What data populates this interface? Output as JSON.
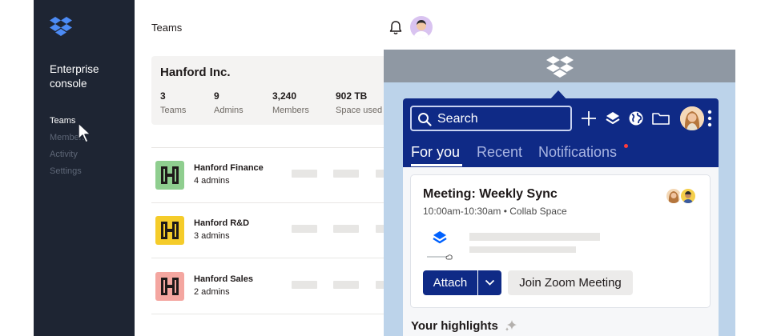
{
  "sidebar": {
    "console_title": "Enterprise console",
    "nav": [
      {
        "label": "Teams",
        "active": true
      },
      {
        "label": "Members",
        "active": false
      },
      {
        "label": "Activity",
        "active": false
      },
      {
        "label": "Settings",
        "active": false
      }
    ],
    "background": "#1e2533",
    "logo_icon": "dropbox-logo-icon"
  },
  "header": {
    "title": "Teams",
    "bell_icon": "bell-icon",
    "avatar": "user-avatar"
  },
  "org": {
    "name": "Hanford Inc.",
    "stats": [
      {
        "value": "3",
        "label": "Teams"
      },
      {
        "value": "9",
        "label": "Admins"
      },
      {
        "value": "3,240",
        "label": "Members"
      },
      {
        "value": "902 TB",
        "label": "Space used"
      }
    ]
  },
  "teams": [
    {
      "name": "Hanford Finance",
      "sub": "4 admins",
      "color": "#8fce8f"
    },
    {
      "name": "Hanford R&D",
      "sub": "3 admins",
      "color": "#f5cc2a"
    },
    {
      "name": "Hanford Sales",
      "sub": "2 admins",
      "color": "#f4a6a0"
    }
  ],
  "popup": {
    "search_placeholder": "Search",
    "tabs": [
      {
        "label": "For you",
        "active": true
      },
      {
        "label": "Recent",
        "active": false
      },
      {
        "label": "Notifications",
        "active": false,
        "has_dot": true
      }
    ],
    "header_icons": [
      "plus-icon",
      "stack-icon",
      "globe-icon",
      "folder-icon"
    ],
    "brand_color": "#0f2a86",
    "meeting": {
      "title": "Meeting: Weekly Sync",
      "time": "10:00am-10:30am • Collab Space",
      "attach_label": "Attach",
      "join_label": "Join Zoom Meeting"
    },
    "highlights_title": "Your highlights"
  }
}
